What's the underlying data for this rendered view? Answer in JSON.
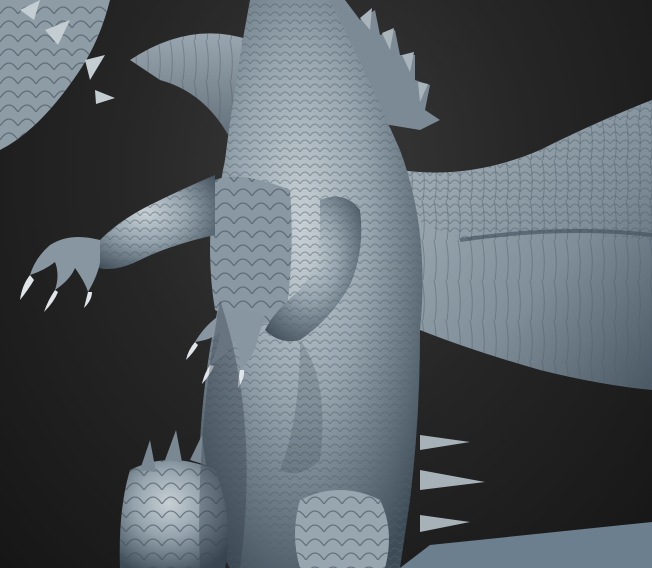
{
  "scene": {
    "subject_icon": "dragon-sculpt-icon",
    "colors": {
      "background": "#1b1b1b",
      "surface_light": "#b9c3c8",
      "surface_mid": "#8795a0",
      "surface_dark": "#3c4a56",
      "floor": "#6a7c8c"
    }
  }
}
